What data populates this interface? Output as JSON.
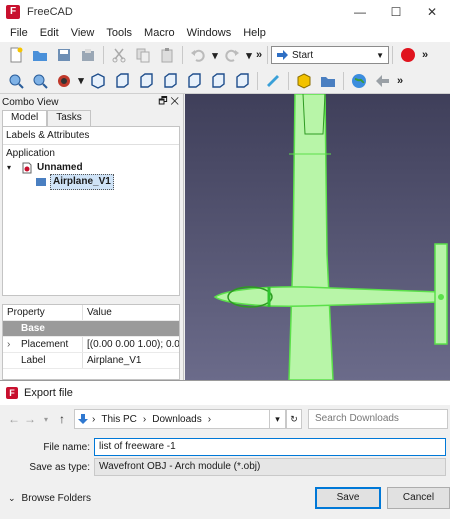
{
  "window": {
    "title": "FreeCAD",
    "minimize": "—",
    "maximize": "☐",
    "close": "✕"
  },
  "menubar": [
    "File",
    "Edit",
    "View",
    "Tools",
    "Macro",
    "Windows",
    "Help"
  ],
  "toolbar": {
    "workbench": "Start",
    "overflow": "»"
  },
  "combo": {
    "title": "Combo View",
    "tabs": [
      "Model",
      "Tasks"
    ],
    "tree_header": "Labels & Attributes",
    "tree": [
      {
        "label": "Application"
      },
      {
        "label": "Unnamed"
      },
      {
        "label": "Airplane_V1"
      }
    ],
    "prop_headers": [
      "Property",
      "Value"
    ],
    "prop_group": "Base",
    "props": [
      {
        "name": "Placement",
        "value": "[(0.00 0.00 1.00); 0.0..."
      },
      {
        "name": "Label",
        "value": "Airplane_V1"
      }
    ]
  },
  "dialog": {
    "title": "Export file",
    "breadcrumb": [
      "This PC",
      "Downloads"
    ],
    "search_placeholder": "Search Downloads",
    "file_name_label": "File name:",
    "file_name_value": "list of freeware -1",
    "save_type_label": "Save as type:",
    "save_type_value": "Wavefront OBJ - Arch module (*.obj)",
    "browse_folders": "Browse Folders",
    "save": "Save",
    "cancel": "Cancel"
  },
  "colors": {
    "accent": "#0078d7",
    "model_green": "#7CFC5A",
    "bg_3d": "#4c4c6a"
  }
}
